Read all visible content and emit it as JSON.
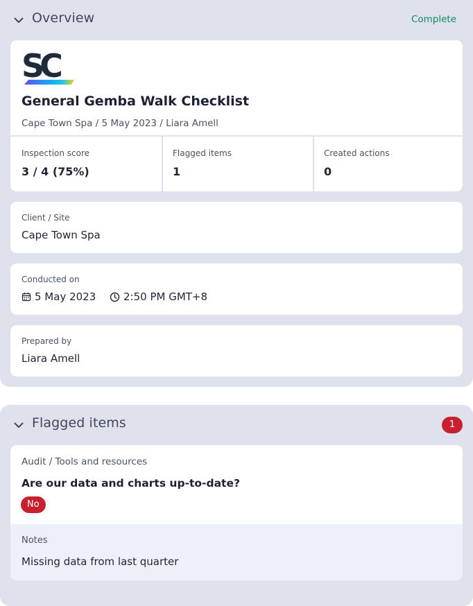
{
  "overview": {
    "title": "Overview",
    "status": "Complete",
    "document": {
      "title": "General Gemba Walk Checklist",
      "subtitle": "Cape Town Spa / 5 May 2023 / Liara Amell"
    },
    "stats": [
      {
        "label": "Inspection score",
        "value": "3 / 4 (75%)"
      },
      {
        "label": "Flagged items",
        "value": "1"
      },
      {
        "label": "Created actions",
        "value": "0"
      }
    ],
    "client_site": {
      "label": "Client / Site",
      "value": "Cape Town Spa"
    },
    "conducted_on": {
      "label": "Conducted on",
      "date": "5 May 2023",
      "time": "2:50 PM GMT+8"
    },
    "prepared_by": {
      "label": "Prepared by",
      "value": "Liara Amell"
    }
  },
  "flagged": {
    "title": "Flagged items",
    "count": "1",
    "item": {
      "path": "Audit / Tools and resources",
      "question": "Are our data and charts up-to-date?",
      "answer": "No",
      "notes_label": "Notes",
      "notes": "Missing data from last quarter"
    }
  },
  "colors": {
    "section_bg": "#dfe2ec",
    "complete_green": "#0f8a5f",
    "flag_red": "#c8202e",
    "notes_bg": "#eef0f9"
  },
  "icons": [
    "chevron-down-icon",
    "calendar-icon",
    "clock-icon",
    "company-logo"
  ]
}
